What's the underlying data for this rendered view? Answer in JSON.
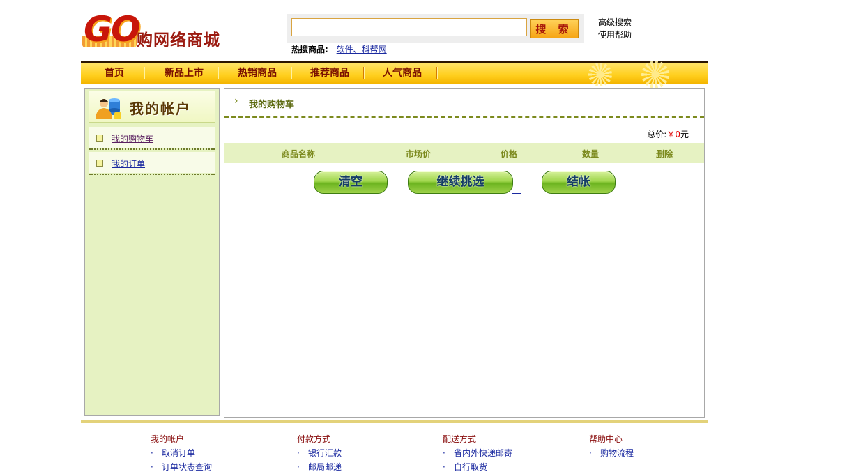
{
  "logo": {
    "mark": "GO",
    "name": "购网络商城"
  },
  "search": {
    "value": "",
    "placeholder": "",
    "button_label": "搜 索"
  },
  "hot_search": {
    "label": "热搜商品:",
    "link": "软件、科帮网"
  },
  "header_links": [
    "高级搜索",
    "使用帮助"
  ],
  "nav": {
    "items": [
      "首页",
      "新品上市",
      "热销商品",
      "推荐商品",
      "人气商品"
    ]
  },
  "sidebar": {
    "title": "我的帐户",
    "items": [
      "我的购物车",
      "我的订单"
    ]
  },
  "cart": {
    "breadcrumb": "我的购物车",
    "total_label": "总价:",
    "total_amount": "￥0",
    "total_unit": "元",
    "columns": [
      "商品名称",
      "市场价",
      "价格",
      "数量",
      "删除"
    ],
    "buttons": {
      "clear": "清空",
      "continue": "继续挑选",
      "checkout": "结帐"
    }
  },
  "footer": {
    "columns": [
      {
        "title": "我的帐户",
        "items": [
          "取消订单",
          "订单状态查询"
        ]
      },
      {
        "title": "付款方式",
        "items": [
          "银行汇款",
          "邮局邮递"
        ]
      },
      {
        "title": "配送方式",
        "items": [
          "省内外快递邮寄",
          "自行取货"
        ]
      },
      {
        "title": "帮助中心",
        "items": [
          "购物流程"
        ]
      }
    ],
    "bullet": "·"
  },
  "colors": {
    "accent": "#ffcf1e",
    "brand_red": "#c8160a",
    "panel_green": "#e6f2c2",
    "price_red": "#e00000"
  }
}
